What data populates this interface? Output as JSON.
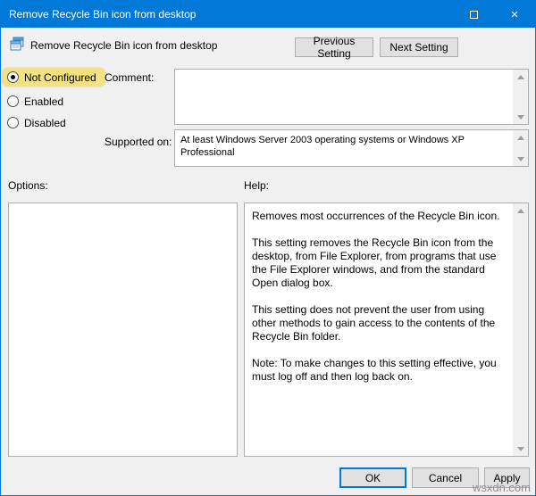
{
  "colors": {
    "titlebar": "#0078d7",
    "accent": "#0078d7",
    "highlight": "#f3e27d",
    "dialog_background": "#f0f0f0"
  },
  "window": {
    "title": "Remove Recycle Bin icon from desktop",
    "close_glyph": "×"
  },
  "header": {
    "setting_title": "Remove Recycle Bin icon from desktop",
    "prev_button": "Previous Setting",
    "next_button": "Next Setting"
  },
  "state_options": [
    {
      "label": "Not Configured",
      "selected": true,
      "highlighted": true
    },
    {
      "label": "Enabled",
      "selected": false,
      "highlighted": false
    },
    {
      "label": "Disabled",
      "selected": false,
      "highlighted": false
    }
  ],
  "comment": {
    "label": "Comment:",
    "value": ""
  },
  "supported_on": {
    "label": "Supported on:",
    "value": "At least Windows Server 2003 operating systems or Windows XP Professional"
  },
  "options": {
    "label": "Options:"
  },
  "help": {
    "label": "Help:",
    "paragraphs": [
      "Removes most occurrences of the Recycle Bin icon.",
      "This setting removes the Recycle Bin icon from the desktop, from File Explorer, from programs that use the File Explorer windows, and from the standard Open dialog box.",
      "This setting does not prevent the user from using other methods to gain access to the contents of the Recycle Bin folder.",
      "Note: To make changes to this setting effective, you must log off and then log back on."
    ]
  },
  "footer": {
    "ok": "OK",
    "cancel": "Cancel",
    "apply": "Apply"
  },
  "watermark": "wsxdn.com"
}
